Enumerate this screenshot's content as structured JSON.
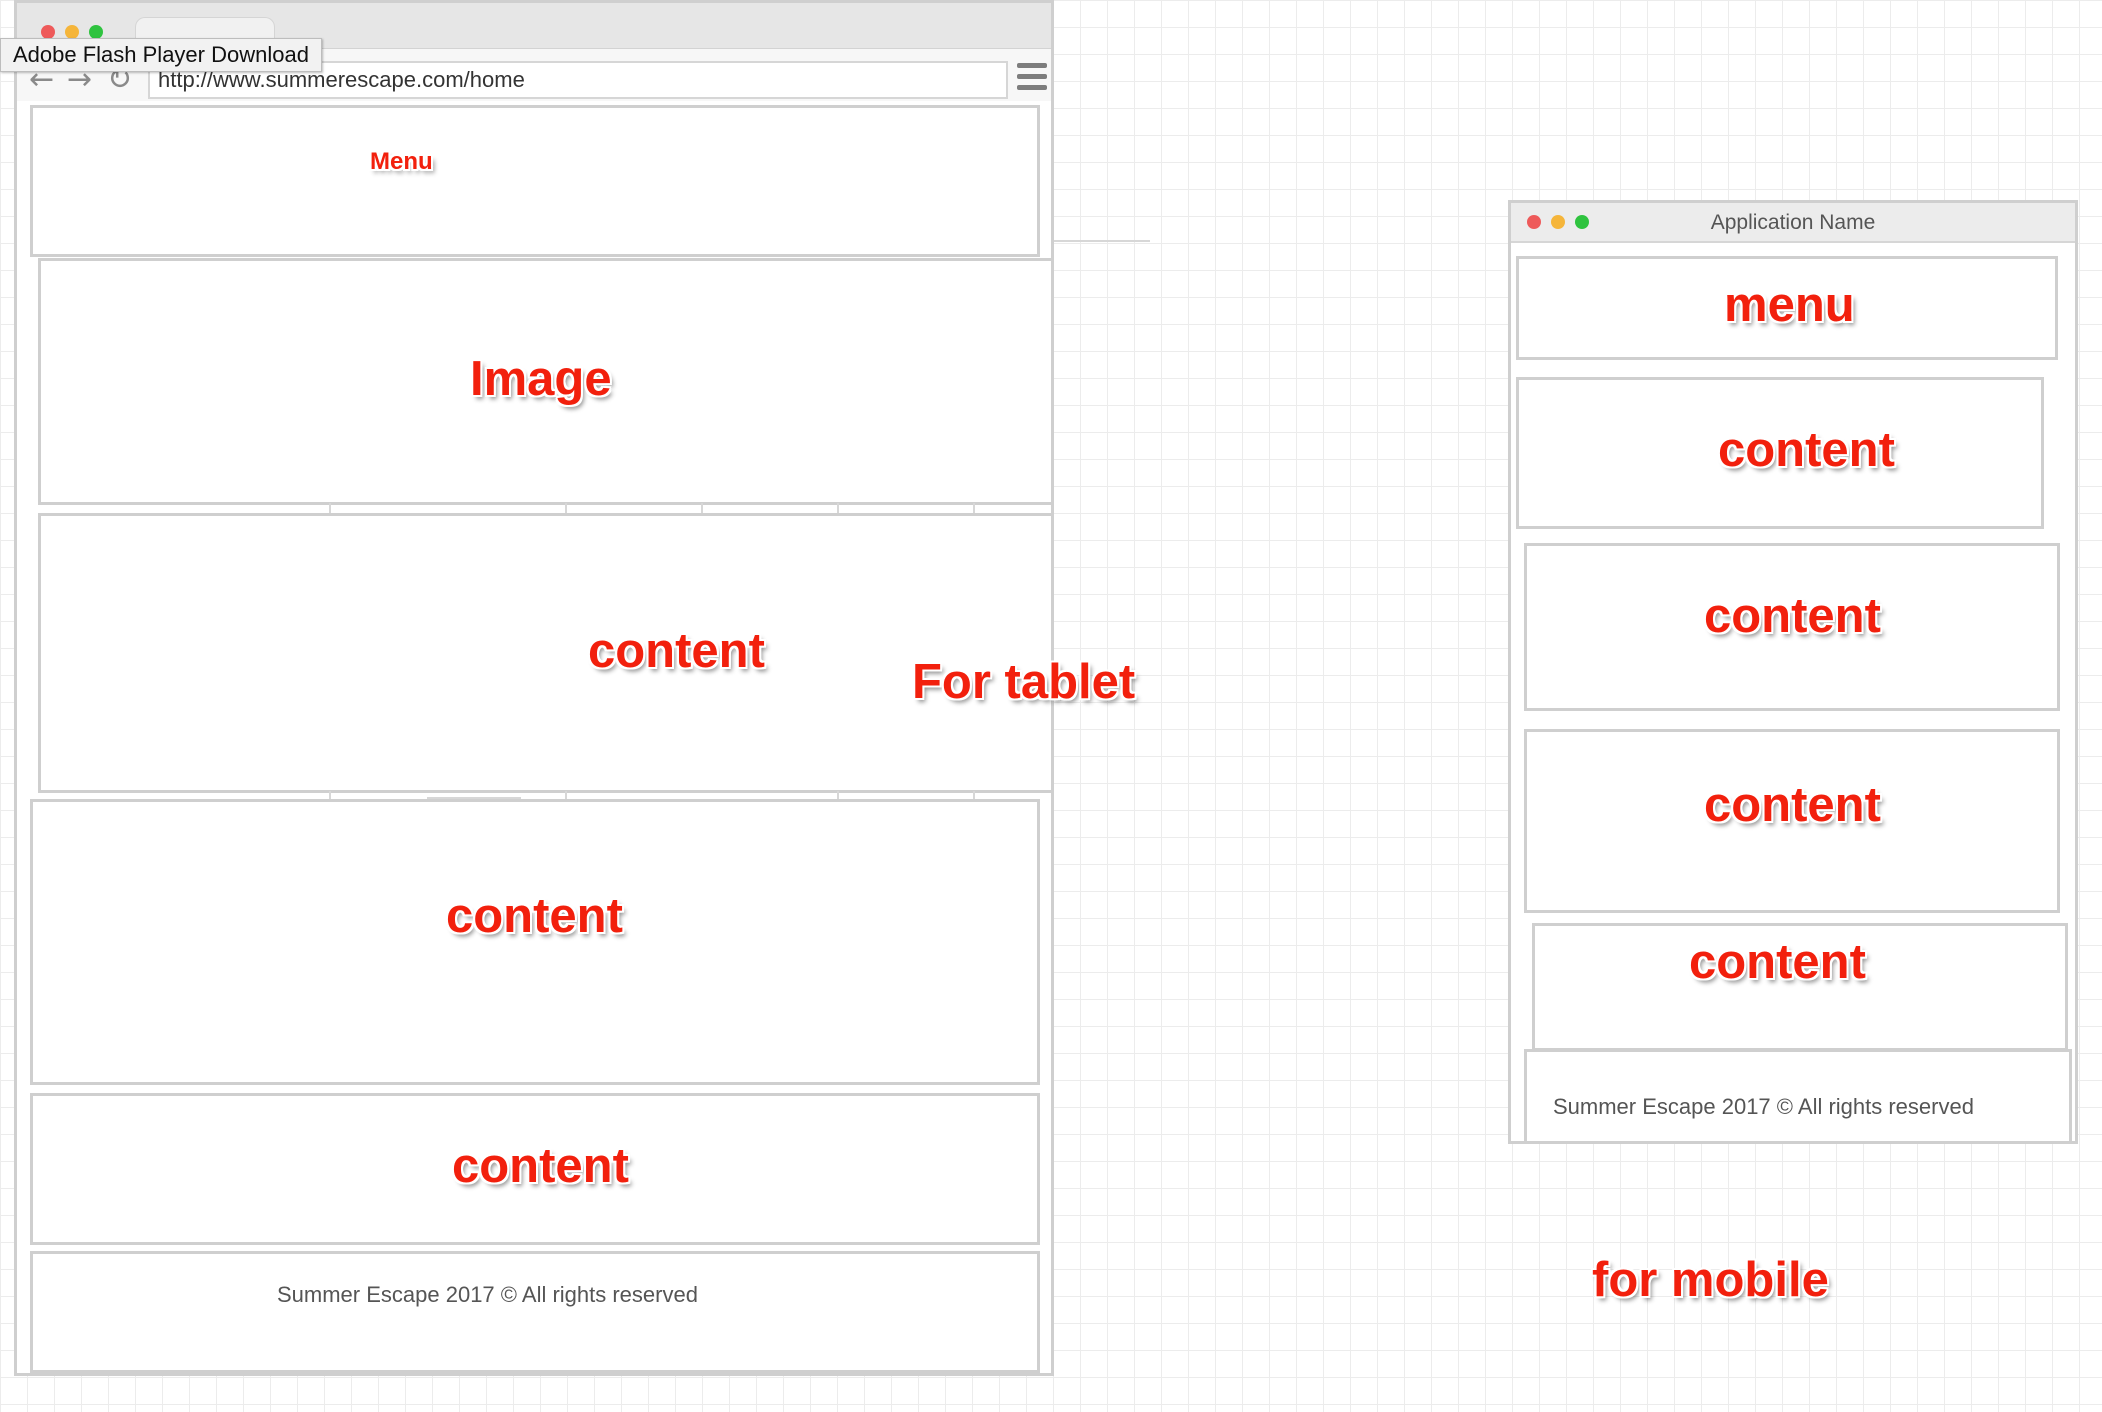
{
  "tablet": {
    "tooltip": "Adobe Flash Player Download",
    "url": "http://www.summerescape.com/home",
    "menu_label": "Menu",
    "image_label": "Image",
    "content_labels": [
      "content",
      "content",
      "content"
    ],
    "footer": "Summer Escape 2017 © All rights reserved",
    "caption": "For tablet"
  },
  "mobile": {
    "app_name": "Application Name",
    "menu_label": "menu",
    "content_labels": [
      "content",
      "content",
      "content",
      "content"
    ],
    "footer": "Summer Escape 2017 © All rights reserved",
    "caption": "for mobile"
  },
  "icons": {
    "back": "back-arrow-icon",
    "forward": "forward-arrow-icon",
    "reload": "reload-icon",
    "menu": "hamburger-menu-icon"
  },
  "colors": {
    "label_red": "#f2200d",
    "window_close": "#ee5a5a",
    "window_minimize": "#f5b53a",
    "window_maximize": "#2fc33f",
    "frame_border": "#cfcfcf"
  }
}
